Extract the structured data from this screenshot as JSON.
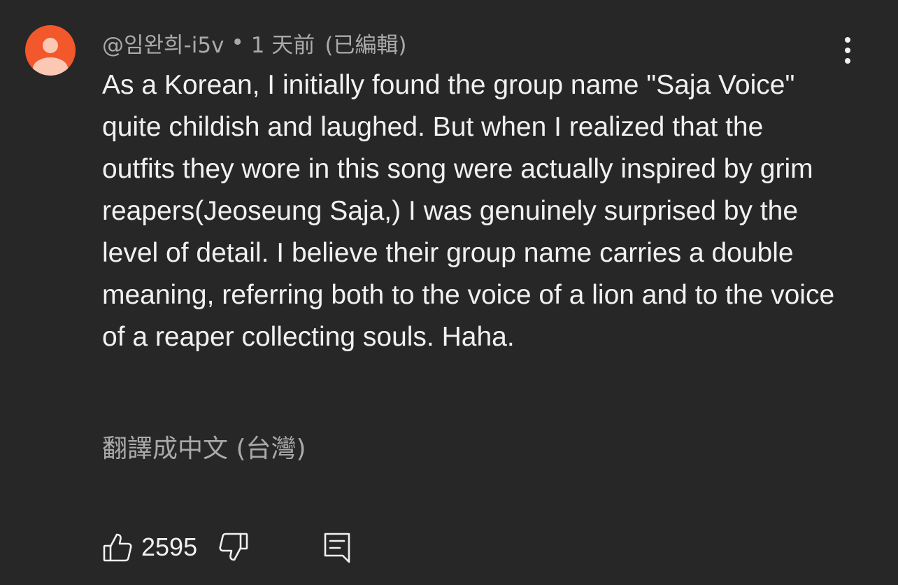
{
  "comment": {
    "author": "@임완희-i5v",
    "separator": "•",
    "time": "1 天前",
    "edited": "(已編輯)",
    "text": "As a Korean, I initially found the group name \"Saja Voice\" quite childish and laughed. But when I realized that the outfits they wore in this song were actually inspired by grim reapers(Jeoseung Saja,) I was genuinely surprised by the level of detail. I believe their group name carries a double meaning, referring both to the voice of a lion and to the voice of a reaper collecting souls. Haha.",
    "translate_label": "翻譯成中文 (台灣)",
    "like_count": "2595"
  },
  "colors": {
    "background": "#272727",
    "avatar": "#f2582b",
    "avatar_figure": "#fbc8b4",
    "primary_text": "#f1f1f1",
    "secondary_text": "#aaaaaa"
  },
  "icons": {
    "avatar": "default-avatar-icon",
    "more": "more-vertical-icon",
    "like": "thumbs-up-icon",
    "dislike": "thumbs-down-icon",
    "reply": "reply-comment-icon"
  }
}
